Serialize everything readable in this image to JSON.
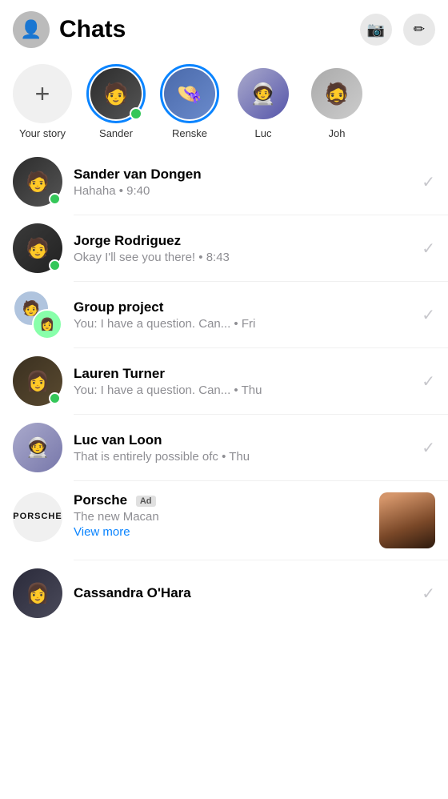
{
  "header": {
    "title": "Chats",
    "camera_label": "📷",
    "compose_label": "✏️"
  },
  "stories": {
    "add_label": "Your story",
    "items": [
      {
        "id": "sander-story",
        "name": "Sander",
        "online": true,
        "has_ring": true,
        "color": "bg-sander"
      },
      {
        "id": "renske-story",
        "name": "Renske",
        "online": false,
        "has_ring": true,
        "color": "bg-renske"
      },
      {
        "id": "luc-story",
        "name": "Luc",
        "online": false,
        "has_ring": false,
        "color": "bg-luc-story"
      },
      {
        "id": "joh-story",
        "name": "Joh",
        "online": false,
        "has_ring": false,
        "color": "bg-joh"
      }
    ]
  },
  "chats": [
    {
      "id": "sander-chat",
      "name": "Sander van Dongen",
      "preview": "Hahaha • 9:40",
      "online": true,
      "type": "single",
      "color": "bg-sander",
      "is_ad": false
    },
    {
      "id": "jorge-chat",
      "name": "Jorge Rodriguez",
      "preview": "Okay I'll see you there! • 8:43",
      "online": true,
      "type": "single",
      "color": "bg-jorge",
      "is_ad": false
    },
    {
      "id": "group-chat",
      "name": "Group project",
      "preview": "You: I have a question. Can... • Fri",
      "online": false,
      "type": "group",
      "color": "bg-group1",
      "color2": "bg-group2",
      "is_ad": false
    },
    {
      "id": "lauren-chat",
      "name": "Lauren Turner",
      "preview": "You: I have a question. Can... • Thu",
      "online": true,
      "type": "single",
      "color": "bg-lauren",
      "is_ad": false
    },
    {
      "id": "luc-chat",
      "name": "Luc van Loon",
      "preview": "That is entirely possible ofc • Thu",
      "online": false,
      "type": "single",
      "color": "bg-luc",
      "is_ad": false
    },
    {
      "id": "porsche-ad",
      "name": "Porsche",
      "ad_label": "Ad",
      "preview": "The new Macan",
      "view_more": "View more",
      "online": false,
      "type": "ad",
      "color": "bg-porsche",
      "is_ad": true
    },
    {
      "id": "cassandra-chat",
      "name": "Cassandra O'Hara",
      "preview": "",
      "online": false,
      "type": "single",
      "color": "bg-cassandra",
      "is_ad": false
    }
  ],
  "icons": {
    "camera": "📷",
    "compose": "✏",
    "checkmark": "✓",
    "plus": "+"
  }
}
